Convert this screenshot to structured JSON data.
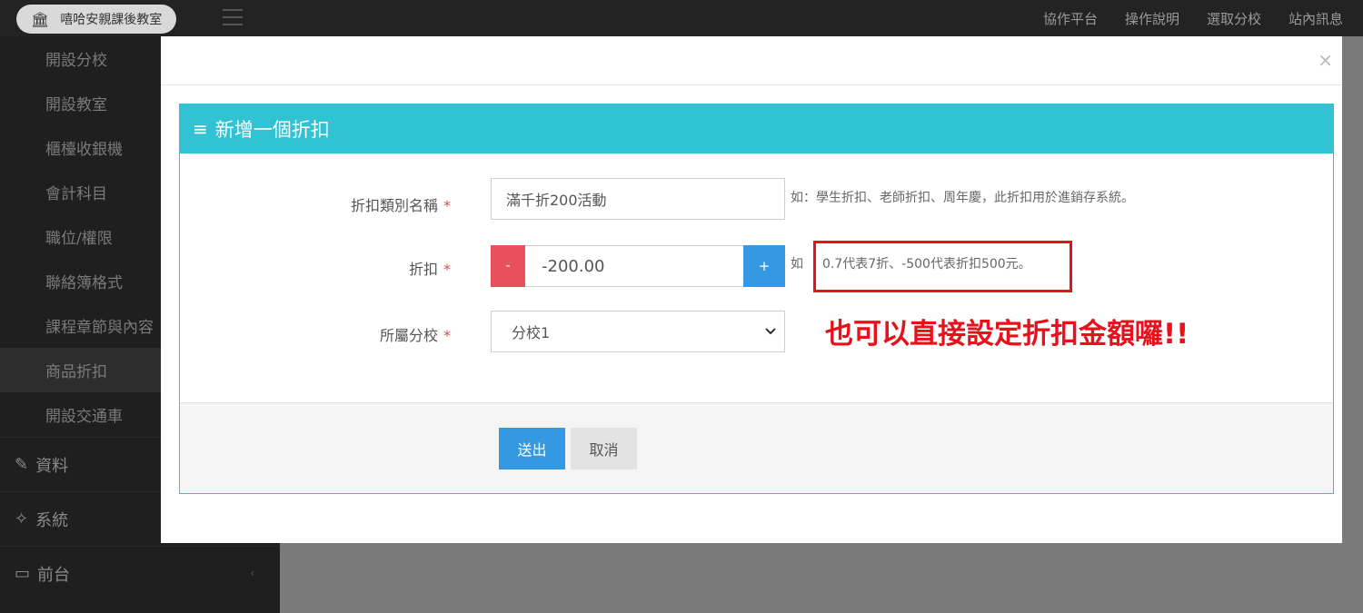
{
  "header": {
    "brand": "嘻哈安親課後教室",
    "nav": [
      "協作平台",
      "操作說明",
      "選取分校",
      "站內訊息"
    ]
  },
  "sidebar": {
    "items": [
      {
        "label": "開設分校"
      },
      {
        "label": "開設教室"
      },
      {
        "label": "櫃檯收銀機"
      },
      {
        "label": "會計科目"
      },
      {
        "label": "職位/權限"
      },
      {
        "label": "聯絡簿格式"
      },
      {
        "label": "課程章節與內容"
      },
      {
        "label": "商品折扣",
        "active": true
      },
      {
        "label": "開設交通車"
      }
    ],
    "groups": [
      {
        "label": "資料",
        "icon": "edit-icon"
      },
      {
        "label": "系統",
        "icon": "handshake-icon"
      },
      {
        "label": "前台",
        "icon": "monitor-icon"
      }
    ]
  },
  "modal": {
    "close": "×",
    "panel_title": "新增一個折扣",
    "form": {
      "name_label": "折扣類別名稱",
      "name_value": "滿千折200活動",
      "name_help": "如：學生折扣、老師折扣、周年慶，此折扣用於進銷存系統。",
      "discount_label": "折扣",
      "minus": "-",
      "discount_value": "-200.00",
      "plus": "+",
      "discount_help_prefix": "如",
      "discount_help": "0.7代表7折、-500代表折扣500元。",
      "branch_label": "所屬分校",
      "branch_value": "分校1",
      "required_mark": "*"
    },
    "annotation": "也可以直接設定折扣金額囉!!",
    "buttons": {
      "submit": "送出",
      "cancel": "取消"
    }
  },
  "colors": {
    "accent": "#31c3d4",
    "primary": "#3499e0",
    "danger": "#e8505b",
    "annotation": "#e8101a"
  }
}
